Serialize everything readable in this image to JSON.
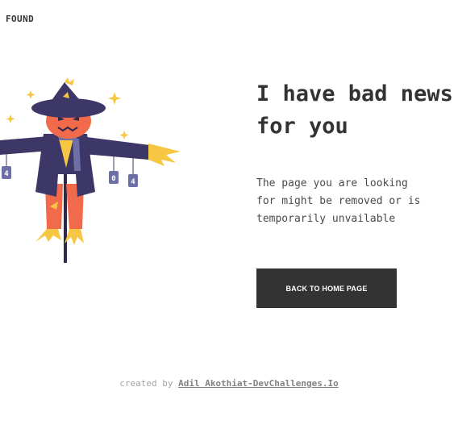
{
  "header": {
    "brand": "FOUND"
  },
  "main": {
    "heading_line1": "I have bad news",
    "heading_line2": "for you",
    "description_line1": "The page you are looking",
    "description_line2": "for might be removed or is",
    "description_line3": "temporarily unvailable",
    "home_button_label": "BACK TO HOME PAGE"
  },
  "illustration": {
    "sign_left": "4",
    "sign_middle": "0",
    "sign_right": "4"
  },
  "footer": {
    "prefix": "created by",
    "author": "Adil Akothiat-DevChallenges.Io"
  },
  "colors": {
    "text": "#333333",
    "button_bg": "#333333",
    "button_text": "#ffffff",
    "footer_text": "#a3a3a3",
    "hat": "#3d3767",
    "pumpkin": "#f06a4b",
    "straw": "#f7c744",
    "sign": "#6e6fa6"
  }
}
